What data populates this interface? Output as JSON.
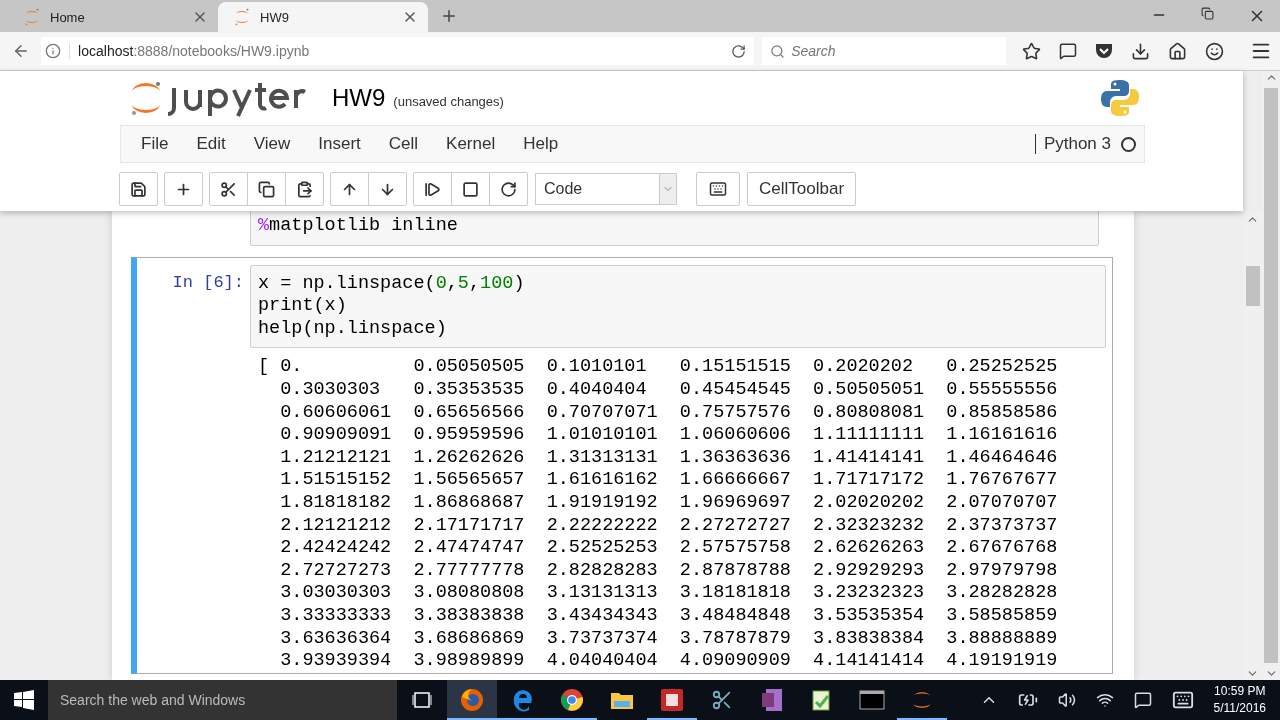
{
  "browser": {
    "tabs": [
      {
        "title": "Home",
        "selected": false
      },
      {
        "title": "HW9",
        "selected": true
      }
    ],
    "url": {
      "host": "localhost",
      "path": ":8888/notebooks/HW9.ipynb"
    },
    "search": {
      "placeholder": "Search"
    }
  },
  "notebook": {
    "title": "HW9",
    "save_status": "(unsaved changes)",
    "menu": [
      "File",
      "Edit",
      "View",
      "Insert",
      "Cell",
      "Kernel",
      "Help"
    ],
    "kernel": {
      "name": "Python 3",
      "busy": false
    },
    "toolbar": {
      "cell_type": "Code",
      "celltoolbar": "CellToolbar"
    },
    "cells": [
      {
        "selected": false,
        "lines": [
          [
            {
              "text": "%",
              "kind": "magic"
            },
            {
              "text": "matplotlib inline",
              "kind": "plain"
            }
          ]
        ]
      },
      {
        "prompt": "In [6]:",
        "selected": true,
        "lines": [
          [
            {
              "text": "x = np.linspace(",
              "kind": "plain"
            },
            {
              "text": "0",
              "kind": "number"
            },
            {
              "text": ",",
              "kind": "plain"
            },
            {
              "text": "5",
              "kind": "number"
            },
            {
              "text": ",",
              "kind": "plain"
            },
            {
              "text": "100",
              "kind": "number"
            },
            {
              "text": ")",
              "kind": "plain"
            }
          ],
          [
            {
              "text": "print(x)",
              "kind": "plain"
            }
          ],
          [
            {
              "text": "help(np.linspace)",
              "kind": "plain"
            }
          ]
        ],
        "output": [
          "[ 0.          0.05050505  0.1010101   0.15151515  0.2020202   0.25252525",
          "  0.3030303   0.35353535  0.4040404   0.45454545  0.50505051  0.55555556",
          "  0.60606061  0.65656566  0.70707071  0.75757576  0.80808081  0.85858586",
          "  0.90909091  0.95959596  1.01010101  1.06060606  1.11111111  1.16161616",
          "  1.21212121  1.26262626  1.31313131  1.36363636  1.41414141  1.46464646",
          "  1.51515152  1.56565657  1.61616162  1.66666667  1.71717172  1.76767677",
          "  1.81818182  1.86868687  1.91919192  1.96969697  2.02020202  2.07070707",
          "  2.12121212  2.17171717  2.22222222  2.27272727  2.32323232  2.37373737",
          "  2.42424242  2.47474747  2.52525253  2.57575758  2.62626263  2.67676768",
          "  2.72727273  2.77777778  2.82828283  2.87878788  2.92929293  2.97979798",
          "  3.03030303  3.08080808  3.13131313  3.18181818  3.23232323  3.28282828",
          "  3.33333333  3.38383838  3.43434343  3.48484848  3.53535354  3.58585859",
          "  3.63636364  3.68686869  3.73737374  3.78787879  3.83838384  3.88888889",
          "  3.93939394  3.98989899  4.04040404  4.09090909  4.14141414  4.19191919"
        ]
      }
    ]
  },
  "taskbar": {
    "search": {
      "placeholder": "Search the web and Windows"
    },
    "time": "10:59 PM",
    "date": "5/11/2016"
  }
}
